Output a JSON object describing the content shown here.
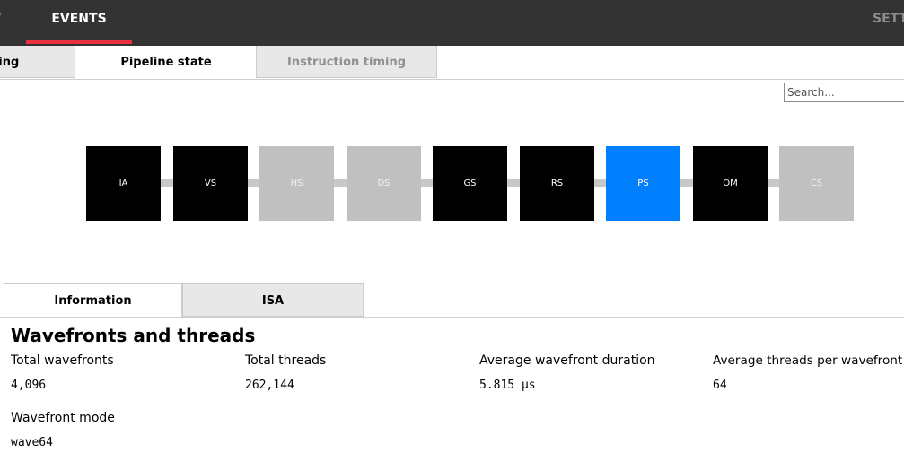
{
  "topnav": {
    "prev_label": "W",
    "active_label": "EVENTS",
    "next_label": "SETT"
  },
  "subtabs": {
    "timing_label": "ning",
    "pipeline_label": "Pipeline state",
    "instruction_label": "Instruction timing"
  },
  "search": {
    "placeholder": "Search..."
  },
  "pipeline": {
    "stages": [
      {
        "label": "IA",
        "state": "enabled"
      },
      {
        "label": "VS",
        "state": "enabled"
      },
      {
        "label": "HS",
        "state": "disabled"
      },
      {
        "label": "DS",
        "state": "disabled"
      },
      {
        "label": "GS",
        "state": "enabled"
      },
      {
        "label": "RS",
        "state": "enabled"
      },
      {
        "label": "PS",
        "state": "selected"
      },
      {
        "label": "OM",
        "state": "enabled"
      },
      {
        "label": "CS",
        "state": "disabled"
      }
    ]
  },
  "lowertabs": {
    "information_label": "Information",
    "isa_label": "ISA"
  },
  "info": {
    "title": "Wavefronts and threads",
    "stats": [
      {
        "label": "Total wavefronts",
        "value": "4,096"
      },
      {
        "label": "Total threads",
        "value": "262,144"
      },
      {
        "label": "Average wavefront duration",
        "value": "5.815 µs"
      },
      {
        "label": "Average threads per wavefront",
        "value": "64"
      },
      {
        "label": "Wavefront mode",
        "value": "wave64"
      }
    ]
  },
  "colors": {
    "topbar_bg": "#333333",
    "accent_underline": "#e8303f",
    "stage_enabled": "#000000",
    "stage_disabled": "#c0c0c0",
    "stage_selected": "#0080ff"
  }
}
